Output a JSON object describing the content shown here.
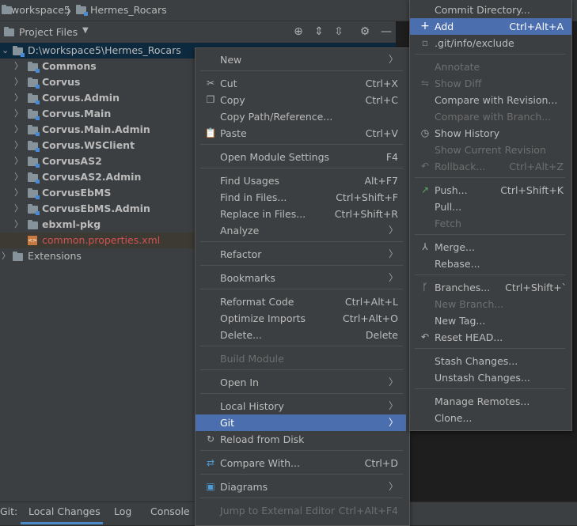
{
  "breadcrumb": {
    "root": "workspace5",
    "project": "Hermes_Rocars"
  },
  "project_panel": {
    "title": "Project Files"
  },
  "tree": {
    "root": "D:\\workspace5\\Hermes_Rocars",
    "items": [
      "Commons",
      "Corvus",
      "Corvus.Admin",
      "Corvus.Main",
      "Corvus.Main.Admin",
      "Corvus.WSClient",
      "CorvusAS2",
      "CorvusAS2.Admin",
      "CorvusEbMS",
      "CorvusEbMS.Admin",
      "ebxml-pkg"
    ],
    "file": "common.properties.xml",
    "extensions": "Extensions"
  },
  "bottom_bar": {
    "git": "Git:",
    "tabs": [
      "Local Changes",
      "Log",
      "Console"
    ]
  },
  "context_menu": {
    "new": "New",
    "cut": "Cut",
    "cut_sc": "Ctrl+X",
    "copy": "Copy",
    "copy_sc": "Ctrl+C",
    "copy_path": "Copy Path/Reference...",
    "paste": "Paste",
    "paste_sc": "Ctrl+V",
    "open_module": "Open Module Settings",
    "open_module_sc": "F4",
    "find_usages": "Find Usages",
    "find_usages_sc": "Alt+F7",
    "find_in_files": "Find in Files...",
    "find_in_files_sc": "Ctrl+Shift+F",
    "replace_in_files": "Replace in Files...",
    "replace_in_files_sc": "Ctrl+Shift+R",
    "analyze": "Analyze",
    "refactor": "Refactor",
    "bookmarks": "Bookmarks",
    "reformat": "Reformat Code",
    "reformat_sc": "Ctrl+Alt+L",
    "optimize": "Optimize Imports",
    "optimize_sc": "Ctrl+Alt+O",
    "delete": "Delete...",
    "delete_sc": "Delete",
    "build_module": "Build Module",
    "open_in": "Open In",
    "local_history": "Local History",
    "git": "Git",
    "reload": "Reload from Disk",
    "compare": "Compare With...",
    "compare_sc": "Ctrl+D",
    "diagrams": "Diagrams",
    "jump": "Jump to External Editor",
    "jump_sc": "Ctrl+Alt+F4"
  },
  "git_menu": {
    "commit": "Commit Directory...",
    "add": "Add",
    "add_sc": "Ctrl+Alt+A",
    "exclude": ".git/info/exclude",
    "annotate": "Annotate",
    "show_diff": "Show Diff",
    "compare_revision": "Compare with Revision...",
    "compare_branch": "Compare with Branch...",
    "show_history": "Show History",
    "show_current": "Show Current Revision",
    "rollback": "Rollback...",
    "rollback_sc": "Ctrl+Alt+Z",
    "push": "Push...",
    "push_sc": "Ctrl+Shift+K",
    "pull": "Pull...",
    "fetch": "Fetch",
    "merge": "Merge...",
    "rebase": "Rebase...",
    "branches": "Branches...",
    "branches_sc": "Ctrl+Shift+`",
    "new_branch": "New Branch...",
    "new_tag": "New Tag...",
    "reset_head": "Reset HEAD...",
    "stash": "Stash Changes...",
    "unstash": "Unstash Changes...",
    "manage_remotes": "Manage Remotes...",
    "clone": "Clone..."
  },
  "colors": {
    "accent": "#4b6eaf",
    "background": "#3c3f41",
    "file_red": "#d25252",
    "module_blue": "#4a8bd6"
  }
}
